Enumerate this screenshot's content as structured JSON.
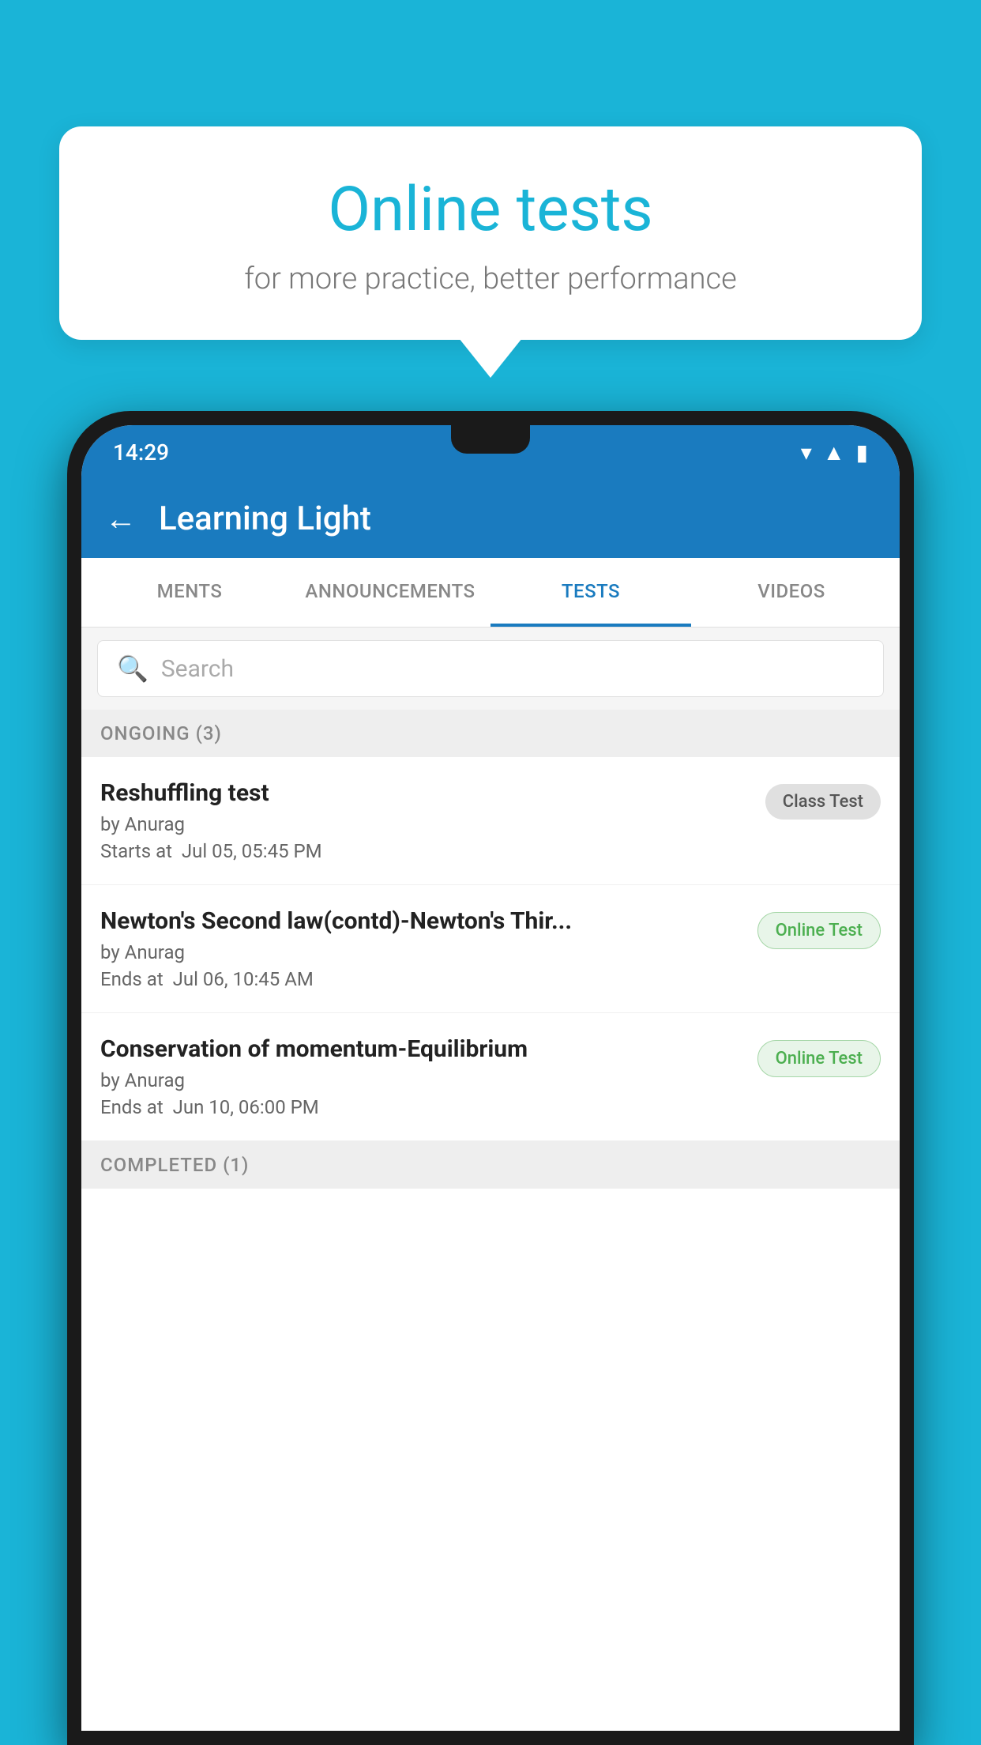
{
  "background_color": "#1ab4d7",
  "bubble": {
    "title": "Online tests",
    "subtitle": "for more practice, better performance"
  },
  "status_bar": {
    "time": "14:29",
    "wifi": "▼",
    "signal": "▲",
    "battery": "▮"
  },
  "app_bar": {
    "title": "Learning Light",
    "back_label": "←"
  },
  "tabs": [
    {
      "label": "MENTS",
      "active": false
    },
    {
      "label": "ANNOUNCEMENTS",
      "active": false
    },
    {
      "label": "TESTS",
      "active": true
    },
    {
      "label": "VIDEOS",
      "active": false
    }
  ],
  "search": {
    "placeholder": "Search"
  },
  "ongoing_section": {
    "label": "ONGOING (3)"
  },
  "tests": [
    {
      "name": "Reshuffling test",
      "author": "by Anurag",
      "date_label": "Starts at",
      "date": "Jul 05, 05:45 PM",
      "badge": "Class Test",
      "badge_type": "class"
    },
    {
      "name": "Newton's Second law(contd)-Newton's Thir...",
      "author": "by Anurag",
      "date_label": "Ends at",
      "date": "Jul 06, 10:45 AM",
      "badge": "Online Test",
      "badge_type": "online"
    },
    {
      "name": "Conservation of momentum-Equilibrium",
      "author": "by Anurag",
      "date_label": "Ends at",
      "date": "Jun 10, 06:00 PM",
      "badge": "Online Test",
      "badge_type": "online"
    }
  ],
  "completed_section": {
    "label": "COMPLETED (1)"
  }
}
